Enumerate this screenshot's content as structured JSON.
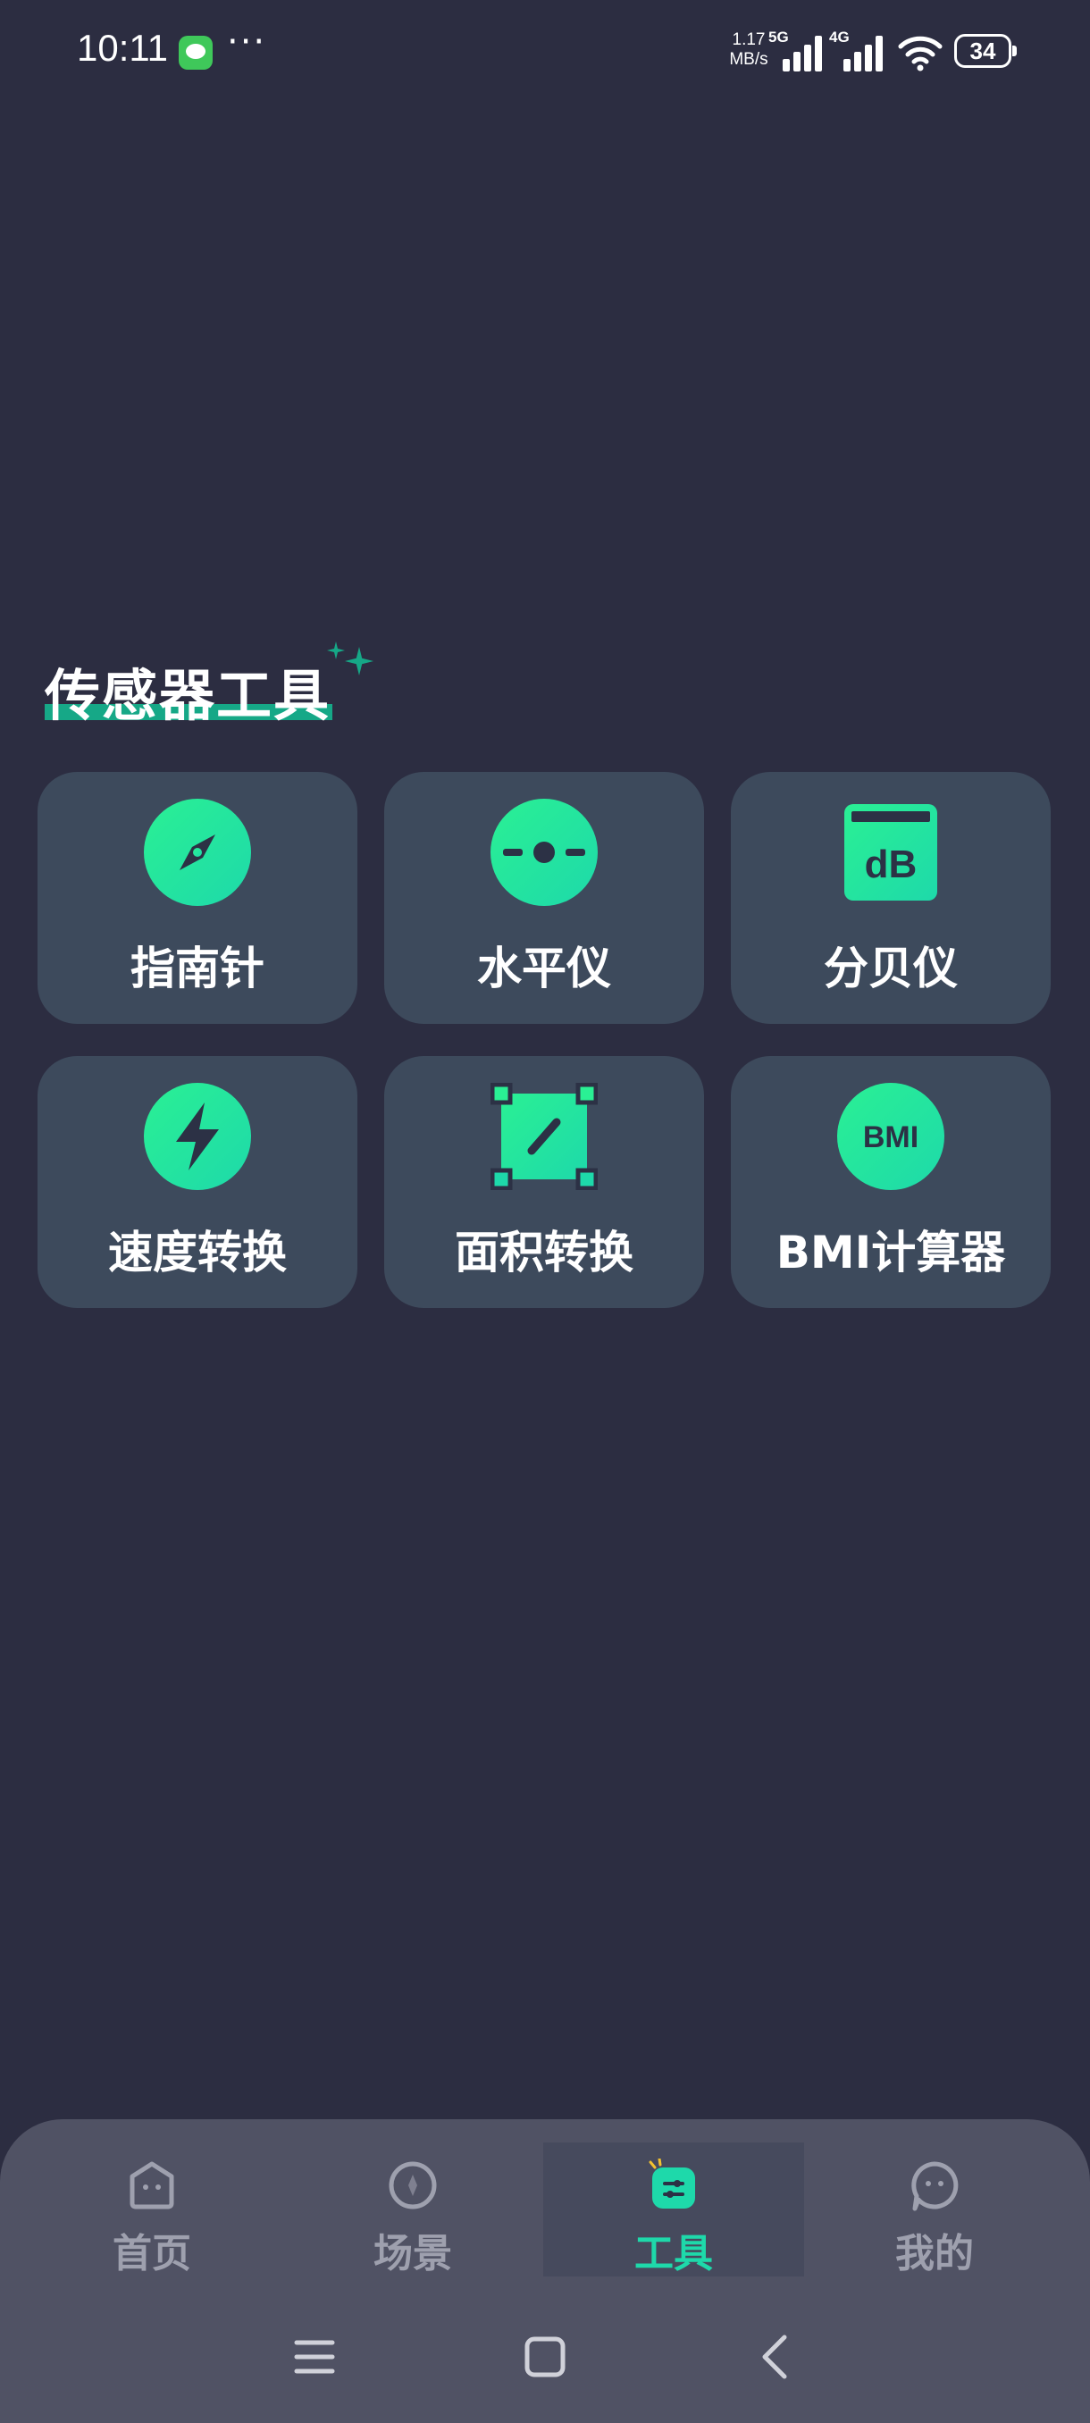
{
  "status_bar": {
    "time": "10:11",
    "more": "···",
    "speed_value": "1.17",
    "speed_unit": "MB/s",
    "net1": "5G",
    "net2": "4G",
    "battery": "34"
  },
  "section": {
    "title": "传感器工具"
  },
  "tools": [
    {
      "label": "指南针",
      "icon": "compass-icon"
    },
    {
      "label": "水平仪",
      "icon": "level-icon"
    },
    {
      "label": "分贝仪",
      "icon": "decibel-meter-icon",
      "icon_text": "dB"
    },
    {
      "label": "速度转换",
      "icon": "lightning-icon"
    },
    {
      "label": "面积转换",
      "icon": "area-icon"
    },
    {
      "label": "BMI计算器",
      "icon": "bmi-icon",
      "icon_text": "BMI"
    }
  ],
  "bottom_nav": {
    "items": [
      {
        "label": "首页",
        "icon": "home-icon"
      },
      {
        "label": "场景",
        "icon": "scene-icon"
      },
      {
        "label": "工具",
        "icon": "tools-icon"
      },
      {
        "label": "我的",
        "icon": "profile-icon"
      }
    ],
    "active_index": 2
  },
  "colors": {
    "background": "#2c2d41",
    "card": "#3d4a5c",
    "accent": "#1ed9aa",
    "icon_gradient_start": "#2af094",
    "icon_gradient_end": "#1ed9aa",
    "nav_background": "#505264"
  }
}
